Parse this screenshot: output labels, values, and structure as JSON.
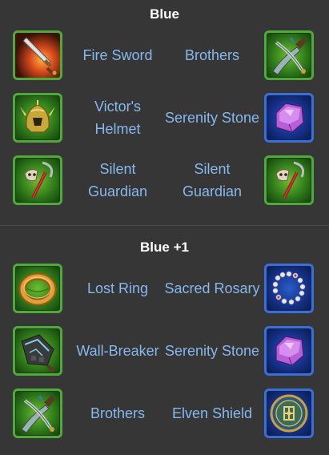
{
  "sections": [
    {
      "title": "Blue",
      "rows": [
        {
          "left": {
            "name": "Fire Sword",
            "icon": "fire-sword-icon",
            "frame": "green"
          },
          "right": {
            "name": "Brothers",
            "icon": "brothers-icon",
            "frame": "green"
          }
        },
        {
          "left": {
            "name": "Victor's Helmet",
            "icon": "victors-helmet-icon",
            "frame": "green"
          },
          "right": {
            "name": "Serenity Stone",
            "icon": "serenity-stone-icon",
            "frame": "blue"
          }
        },
        {
          "left": {
            "name": "Silent Guardian",
            "icon": "silent-guardian-icon",
            "frame": "green"
          },
          "right": {
            "name": "Silent Guardian",
            "icon": "silent-guardian-icon",
            "frame": "green"
          }
        }
      ]
    },
    {
      "title": "Blue +1",
      "rows": [
        {
          "left": {
            "name": "Lost Ring",
            "icon": "lost-ring-icon",
            "frame": "green"
          },
          "right": {
            "name": "Sacred Rosary",
            "icon": "sacred-rosary-icon",
            "frame": "blue"
          }
        },
        {
          "left": {
            "name": "Wall-Breaker",
            "icon": "wall-breaker-icon",
            "frame": "green"
          },
          "right": {
            "name": "Serenity Stone",
            "icon": "serenity-stone-icon",
            "frame": "blue"
          }
        },
        {
          "left": {
            "name": "Brothers",
            "icon": "brothers-icon",
            "frame": "green"
          },
          "right": {
            "name": "Elven Shield",
            "icon": "elven-shield-icon",
            "frame": "blue"
          }
        }
      ]
    }
  ],
  "colors": {
    "background": "#363636",
    "title_text": "#ffffff",
    "item_text": "#86b8ee",
    "green_frame": "#4faa3a",
    "blue_frame": "#3b6fd6",
    "divider": "#4a4a4a"
  }
}
